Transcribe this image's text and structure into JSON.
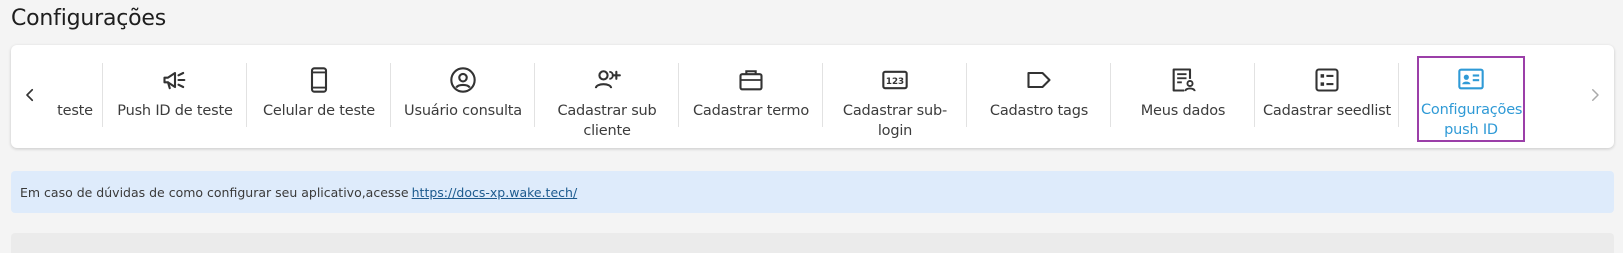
{
  "page": {
    "title": "Configurações"
  },
  "tabs": [
    {
      "label": "teste",
      "icon": "phone-icon"
    },
    {
      "label": "Push ID de teste",
      "icon": "megaphone-icon"
    },
    {
      "label": "Celular de teste",
      "icon": "smartphone-icon"
    },
    {
      "label": "Usuário consulta",
      "icon": "user-circle-icon"
    },
    {
      "label": "Cadastrar sub cliente",
      "icon": "user-add-icon"
    },
    {
      "label": "Cadastrar termo",
      "icon": "briefcase-icon"
    },
    {
      "label": "Cadastrar sub-login",
      "icon": "numeric-box-icon"
    },
    {
      "label": "Cadastro tags",
      "icon": "tag-icon"
    },
    {
      "label": "Meus dados",
      "icon": "user-document-icon"
    },
    {
      "label": "Cadastrar seedlist",
      "icon": "checklist-icon"
    },
    {
      "label": "Configurações push ID",
      "icon": "id-card-icon",
      "active": true
    }
  ],
  "colors": {
    "active_label": "#2f9ad6",
    "active_border": "#9b3fa8",
    "info_bg": "#deebfb"
  },
  "info": {
    "text": "Em caso de dúvidas de como configurar seu aplicativo,acesse",
    "link": "https://docs-xp.wake.tech/"
  }
}
